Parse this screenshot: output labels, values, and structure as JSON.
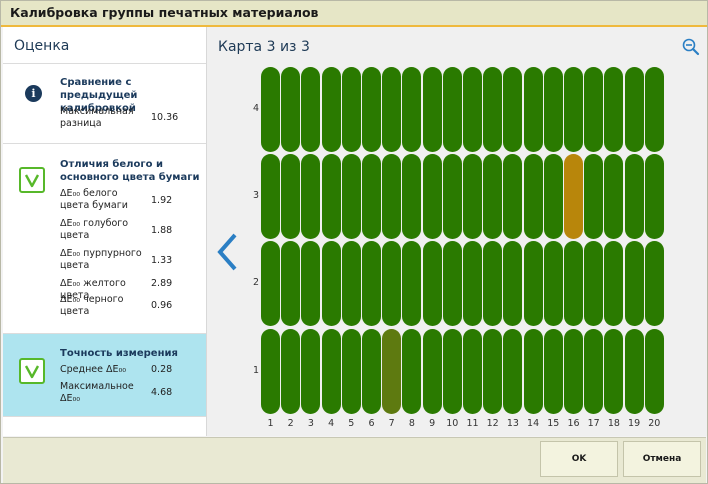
{
  "window": {
    "title": "Калибровка группы печатных материалов"
  },
  "sidebar": {
    "header": "Оценка",
    "items": [
      {
        "icon": "info-icon",
        "heading": "Сравнение с предыдущей калибровкой",
        "rows": [
          {
            "label": "Максимальная разница",
            "value": "10.36"
          }
        ]
      },
      {
        "icon": "check-icon",
        "heading": "Отличия белого и основного цвета бумаги",
        "rows": [
          {
            "label": "ΔE₀₀ белого цвета бумаги",
            "value": "1.92"
          },
          {
            "label": "ΔE₀₀ голубого цвета",
            "value": "1.88"
          },
          {
            "label": "ΔE₀₀ пурпурного цвета",
            "value": "1.33"
          },
          {
            "label": "ΔE₀₀ желтого цвета",
            "value": "2.89"
          },
          {
            "label": "ΔE₀₀ черного цвета",
            "value": "0.96"
          }
        ]
      },
      {
        "icon": "check-icon",
        "heading": "Точность измерения",
        "selected": true,
        "rows": [
          {
            "label": "Среднее ΔE₀₀",
            "value": "0.28"
          },
          {
            "label": "Максимальное ΔE₀₀",
            "value": "4.68"
          }
        ]
      }
    ]
  },
  "main": {
    "card_title": "Карта 3 из 3",
    "grid": {
      "columns": [
        "1",
        "2",
        "3",
        "4",
        "5",
        "6",
        "7",
        "8",
        "9",
        "10",
        "11",
        "12",
        "13",
        "14",
        "15",
        "16",
        "17",
        "18",
        "19",
        "20"
      ],
      "rows": [
        "4",
        "3",
        "2",
        "1"
      ],
      "colors": {
        "ok": "#2a7a00",
        "warning": "#b8860b",
        "marginal": "#5e7a10"
      },
      "highlights": [
        {
          "row": "3",
          "column": "16",
          "status": "warning"
        },
        {
          "row": "1",
          "column": "7",
          "status": "marginal"
        }
      ]
    }
  },
  "footer": {
    "ok_label": "OK",
    "cancel_label": "Отмена"
  }
}
